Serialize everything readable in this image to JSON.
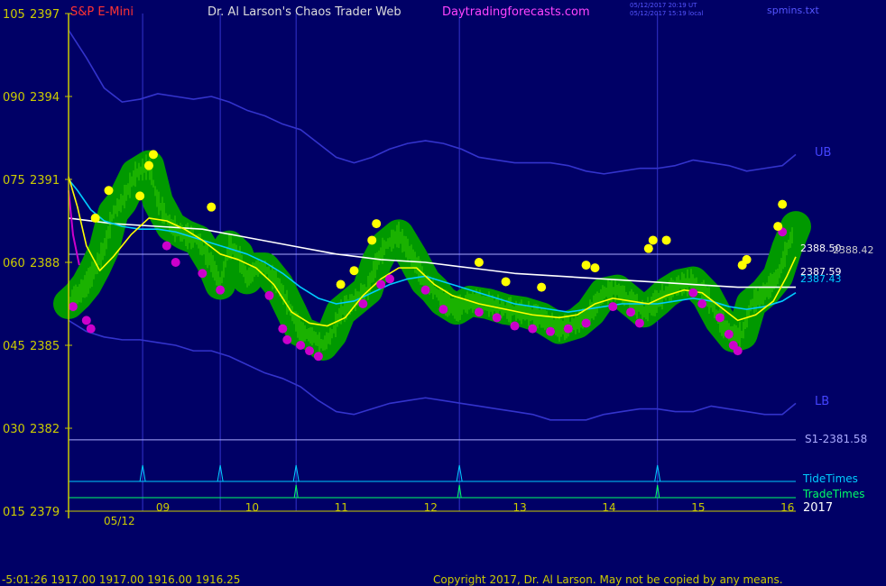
{
  "header": {
    "symbol": "S&P E-Mini",
    "title": "Dr. Al Larson's Chaos Trader Web",
    "site": "Daytradingforecasts.com",
    "timestamp_ut": "05/12/2017 20:19 UT",
    "timestamp_local": "05/12/2017 15:19 local",
    "file": "spmins.txt"
  },
  "footer": {
    "quote": "-5:01:26  1917.00 1917.00 1916.00 1916.25",
    "copyright": "Copyright 2017, Dr. Al Larson. May not be copied by any means."
  },
  "colors": {
    "background": "#000066",
    "axis": "#cccc00",
    "band": "#3333cc",
    "price_bars": "#33cc00",
    "halo": "#009900",
    "fast_ma": "#ffff00",
    "mid_ma": "#00ccff",
    "slow_ma": "#ffffff",
    "extreme_low": "#cc00cc",
    "extreme_high": "#ffff00",
    "tide": "#00ccff",
    "trade": "#00ff66"
  },
  "chart_data": {
    "type": "line",
    "y_left_labels": [
      {
        "osc": "105",
        "price": "2397",
        "value": 2397
      },
      {
        "osc": "090",
        "price": "2394",
        "value": 2394
      },
      {
        "osc": "075",
        "price": "2391",
        "value": 2391
      },
      {
        "osc": "060",
        "price": "2388",
        "value": 2388
      },
      {
        "osc": "045",
        "price": "2385",
        "value": 2385
      },
      {
        "osc": "030",
        "price": "2382",
        "value": 2382
      },
      {
        "osc": "015",
        "price": "2379",
        "value": 2379
      }
    ],
    "ylim": [
      2379,
      2397
    ],
    "xlim": [
      8.0,
      16.15
    ],
    "x_ticks": [
      "09",
      "10",
      "11",
      "12",
      "13",
      "14",
      "15",
      "16"
    ],
    "date_label": "05/12",
    "year_label": "2017",
    "band_labels": {
      "upper": "UB",
      "lower": "LB"
    },
    "reference_lines": [
      {
        "label": "S1-2381.58",
        "value": 2381.58
      }
    ],
    "right_value_labels": [
      "2388.50",
      "2388.42",
      "2387.59",
      "2387.43"
    ],
    "markers": {
      "tide_label": "TideTimes",
      "trade_label": "TradeTimes",
      "vertical_times": [
        8.83,
        9.7,
        10.55,
        12.38,
        14.6
      ],
      "tide_times": [
        8.83,
        9.7,
        10.55,
        12.38,
        14.6
      ],
      "trade_times": [
        10.55,
        12.38,
        14.6
      ]
    },
    "series": [
      {
        "role": "price",
        "x": [
          8.0,
          8.1,
          8.2,
          8.3,
          8.4,
          8.5,
          8.6,
          8.75,
          8.9,
          9.0,
          9.15,
          9.3,
          9.45,
          9.6,
          9.7,
          9.8,
          9.9,
          10.0,
          10.1,
          10.2,
          10.35,
          10.5,
          10.6,
          10.75,
          10.85,
          10.95,
          11.05,
          11.2,
          11.35,
          11.45,
          11.55,
          11.7,
          11.85,
          12.0,
          12.1,
          12.2,
          12.35,
          12.5,
          12.7,
          12.9,
          13.1,
          13.3,
          13.5,
          13.7,
          13.85,
          14.0,
          14.15,
          14.3,
          14.45,
          14.6,
          14.7,
          14.85,
          15.0,
          15.15,
          15.3,
          15.45,
          15.55,
          15.65,
          15.8,
          15.95,
          16.05,
          16.15
        ],
        "y": [
          2386.5,
          2386.8,
          2387.2,
          2387.8,
          2388.5,
          2389.8,
          2390.2,
          2391.2,
          2391.5,
          2390.2,
          2389.3,
          2389.0,
          2388.8,
          2388.0,
          2387.2,
          2388.6,
          2388.3,
          2387.4,
          2387.8,
          2387.8,
          2387.2,
          2386.2,
          2385.5,
          2385.3,
          2385.0,
          2385.4,
          2386.2,
          2386.6,
          2387.0,
          2388.0,
          2388.6,
          2389.0,
          2388.2,
          2387.3,
          2387.0,
          2386.6,
          2386.3,
          2386.6,
          2386.5,
          2386.3,
          2386.2,
          2386.0,
          2385.6,
          2385.8,
          2386.2,
          2386.9,
          2387.0,
          2386.6,
          2386.2,
          2386.6,
          2386.9,
          2387.2,
          2387.3,
          2386.8,
          2385.9,
          2385.3,
          2385.4,
          2386.5,
          2386.9,
          2387.5,
          2388.5,
          2389.3
        ]
      },
      {
        "role": "fast_ma",
        "x": [
          8.0,
          8.1,
          8.2,
          8.35,
          8.5,
          8.7,
          8.9,
          9.1,
          9.3,
          9.5,
          9.7,
          9.9,
          10.1,
          10.3,
          10.5,
          10.7,
          10.9,
          11.1,
          11.3,
          11.5,
          11.7,
          11.9,
          12.1,
          12.3,
          12.6,
          12.9,
          13.2,
          13.5,
          13.7,
          13.9,
          14.1,
          14.3,
          14.5,
          14.7,
          14.9,
          15.1,
          15.3,
          15.5,
          15.7,
          15.9,
          16.05,
          16.15
        ],
        "y": [
          2391.1,
          2390.0,
          2388.6,
          2387.7,
          2388.2,
          2389.0,
          2389.6,
          2389.5,
          2389.2,
          2388.8,
          2388.3,
          2388.1,
          2387.8,
          2387.2,
          2386.2,
          2385.8,
          2385.7,
          2386.0,
          2386.8,
          2387.4,
          2387.8,
          2387.8,
          2387.2,
          2386.8,
          2386.5,
          2386.3,
          2386.1,
          2386.0,
          2386.1,
          2386.5,
          2386.7,
          2386.6,
          2386.5,
          2386.8,
          2387.0,
          2386.9,
          2386.4,
          2385.9,
          2386.1,
          2386.6,
          2387.5,
          2388.2
        ]
      },
      {
        "role": "mid_ma",
        "x": [
          8.0,
          8.1,
          8.25,
          8.4,
          8.6,
          8.8,
          9.0,
          9.2,
          9.4,
          9.6,
          9.8,
          10.0,
          10.2,
          10.4,
          10.6,
          10.8,
          11.0,
          11.2,
          11.4,
          11.6,
          11.8,
          12.0,
          12.2,
          12.4,
          12.6,
          12.8,
          13.0,
          13.2,
          13.4,
          13.6,
          13.8,
          14.0,
          14.2,
          14.4,
          14.6,
          14.8,
          15.0,
          15.2,
          15.4,
          15.6,
          15.8,
          16.0,
          16.15
        ],
        "y": [
          2391.0,
          2390.6,
          2389.9,
          2389.5,
          2389.3,
          2389.2,
          2389.2,
          2389.1,
          2388.9,
          2388.7,
          2388.5,
          2388.3,
          2388.0,
          2387.6,
          2387.1,
          2386.7,
          2386.5,
          2386.6,
          2386.9,
          2387.2,
          2387.4,
          2387.5,
          2387.3,
          2387.1,
          2386.9,
          2386.7,
          2386.5,
          2386.4,
          2386.3,
          2386.2,
          2386.3,
          2386.4,
          2386.5,
          2386.5,
          2386.5,
          2386.6,
          2386.7,
          2386.6,
          2386.4,
          2386.3,
          2386.4,
          2386.6,
          2386.9
        ]
      },
      {
        "role": "slow_ma",
        "x": [
          8.0,
          8.5,
          9.0,
          9.5,
          10.0,
          10.5,
          11.0,
          11.5,
          12.0,
          12.5,
          13.0,
          13.5,
          14.0,
          14.5,
          15.0,
          15.5,
          16.0,
          16.15
        ],
        "y": [
          2389.6,
          2389.4,
          2389.3,
          2389.2,
          2388.9,
          2388.6,
          2388.3,
          2388.1,
          2388.0,
          2387.8,
          2387.6,
          2387.5,
          2387.4,
          2387.3,
          2387.2,
          2387.1,
          2387.1,
          2387.1
        ]
      },
      {
        "role": "upper_band",
        "x": [
          8.0,
          8.2,
          8.4,
          8.6,
          8.8,
          9.0,
          9.2,
          9.4,
          9.6,
          9.8,
          10.0,
          10.2,
          10.4,
          10.6,
          10.8,
          11.0,
          11.2,
          11.4,
          11.6,
          11.8,
          12.0,
          12.2,
          12.4,
          12.6,
          12.8,
          13.0,
          13.2,
          13.4,
          13.6,
          13.8,
          14.0,
          14.2,
          14.4,
          14.6,
          14.8,
          15.0,
          15.2,
          15.4,
          15.6,
          15.8,
          16.0,
          16.15
        ],
        "y": [
          2396.4,
          2395.4,
          2394.3,
          2393.8,
          2393.9,
          2394.1,
          2394.0,
          2393.9,
          2394.0,
          2393.8,
          2393.5,
          2393.3,
          2393.0,
          2392.8,
          2392.3,
          2391.8,
          2391.6,
          2391.8,
          2392.1,
          2392.3,
          2392.4,
          2392.3,
          2392.1,
          2391.8,
          2391.7,
          2391.6,
          2391.6,
          2391.6,
          2391.5,
          2391.3,
          2391.2,
          2391.3,
          2391.4,
          2391.4,
          2391.5,
          2391.7,
          2391.6,
          2391.5,
          2391.3,
          2391.4,
          2391.5,
          2391.9
        ]
      },
      {
        "role": "lower_band",
        "x": [
          8.0,
          8.2,
          8.4,
          8.6,
          8.8,
          9.0,
          9.2,
          9.4,
          9.6,
          9.8,
          10.0,
          10.2,
          10.4,
          10.6,
          10.8,
          11.0,
          11.2,
          11.4,
          11.6,
          11.8,
          12.0,
          12.2,
          12.4,
          12.6,
          12.8,
          13.0,
          13.2,
          13.4,
          13.6,
          13.8,
          14.0,
          14.2,
          14.4,
          14.6,
          14.8,
          15.0,
          15.2,
          15.4,
          15.6,
          15.8,
          16.0,
          16.15
        ],
        "y": [
          2385.9,
          2385.5,
          2385.3,
          2385.2,
          2385.2,
          2385.1,
          2385.0,
          2384.8,
          2384.8,
          2384.6,
          2384.3,
          2384.0,
          2383.8,
          2383.5,
          2383.0,
          2382.6,
          2382.5,
          2382.7,
          2382.9,
          2383.0,
          2383.1,
          2383.0,
          2382.9,
          2382.8,
          2382.7,
          2382.6,
          2382.5,
          2382.3,
          2382.3,
          2382.3,
          2382.5,
          2382.6,
          2382.7,
          2382.7,
          2382.6,
          2382.6,
          2382.8,
          2382.7,
          2382.6,
          2382.5,
          2382.5,
          2382.9
        ]
      }
    ],
    "extreme_lows": [
      [
        8.05,
        2386.4
      ],
      [
        8.2,
        2385.9
      ],
      [
        8.25,
        2385.6
      ],
      [
        9.1,
        2388.6
      ],
      [
        9.2,
        2388.0
      ],
      [
        9.5,
        2387.6
      ],
      [
        9.7,
        2387.0
      ],
      [
        10.25,
        2386.8
      ],
      [
        10.4,
        2385.6
      ],
      [
        10.45,
        2385.2
      ],
      [
        10.6,
        2385.0
      ],
      [
        10.7,
        2384.8
      ],
      [
        10.8,
        2384.6
      ],
      [
        11.3,
        2386.5
      ],
      [
        11.5,
        2387.2
      ],
      [
        11.6,
        2387.4
      ],
      [
        12.0,
        2387.0
      ],
      [
        12.2,
        2386.3
      ],
      [
        12.6,
        2386.2
      ],
      [
        12.8,
        2386.0
      ],
      [
        13.0,
        2385.7
      ],
      [
        13.2,
        2385.6
      ],
      [
        13.4,
        2385.5
      ],
      [
        13.6,
        2385.6
      ],
      [
        13.8,
        2385.8
      ],
      [
        14.1,
        2386.4
      ],
      [
        14.3,
        2386.2
      ],
      [
        14.4,
        2385.8
      ],
      [
        15.0,
        2386.9
      ],
      [
        15.1,
        2386.5
      ],
      [
        15.3,
        2386.0
      ],
      [
        15.4,
        2385.4
      ],
      [
        15.45,
        2385.0
      ],
      [
        15.5,
        2384.8
      ],
      [
        16.0,
        2389.1
      ]
    ],
    "extreme_highs": [
      [
        8.3,
        2389.6
      ],
      [
        8.45,
        2390.6
      ],
      [
        8.8,
        2390.4
      ],
      [
        8.9,
        2391.5
      ],
      [
        8.95,
        2391.9
      ],
      [
        9.6,
        2390.0
      ],
      [
        11.05,
        2387.2
      ],
      [
        11.2,
        2387.7
      ],
      [
        11.4,
        2388.8
      ],
      [
        11.45,
        2389.4
      ],
      [
        12.6,
        2388.0
      ],
      [
        12.9,
        2387.3
      ],
      [
        13.3,
        2387.1
      ],
      [
        13.8,
        2387.9
      ],
      [
        13.9,
        2387.8
      ],
      [
        14.5,
        2388.5
      ],
      [
        14.55,
        2388.8
      ],
      [
        14.7,
        2388.8
      ],
      [
        15.55,
        2387.9
      ],
      [
        15.6,
        2388.1
      ],
      [
        15.95,
        2389.3
      ],
      [
        16.0,
        2390.1
      ]
    ]
  }
}
